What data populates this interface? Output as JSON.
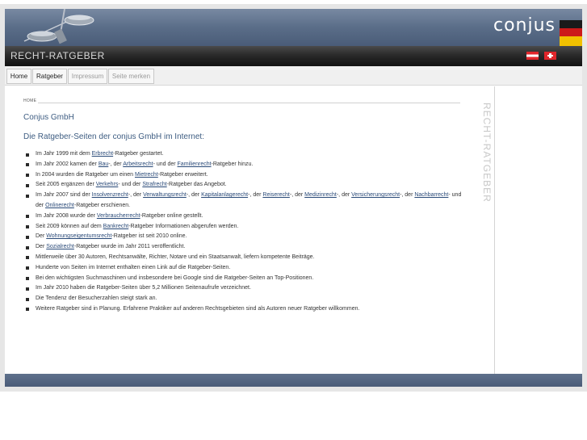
{
  "header": {
    "logo_text": "conjus",
    "site_title": "RECHT-RATGEBER",
    "flags": [
      "austria-flag-icon",
      "switzerland-flag-icon"
    ]
  },
  "nav": {
    "tabs": [
      {
        "label": "Home",
        "state": "active"
      },
      {
        "label": "Ratgeber",
        "state": "active"
      },
      {
        "label": "Impressum",
        "state": "inactive"
      },
      {
        "label": "Seite merken",
        "state": "inactive"
      }
    ]
  },
  "content": {
    "breadcrumb": "HOME",
    "company": "Conjus GmbH",
    "intro": "Die Ratgeber-Seiten der conjus GmbH im Internet:",
    "items": [
      [
        "Im Jahr 1999 mit dem ",
        {
          "link": "Erbrecht"
        },
        "-Ratgeber gestartet."
      ],
      [
        "Im Jahr 2002 kamen der ",
        {
          "link": "Bau"
        },
        "-, der ",
        {
          "link": "Arbeitsrecht"
        },
        "- und der ",
        {
          "link": "Familienrecht"
        },
        "-Ratgeber hinzu."
      ],
      [
        "In 2004 wurden die Ratgeber um einen ",
        {
          "link": "Mietrecht"
        },
        "-Ratgeber erweitert."
      ],
      [
        "Seit 2005 ergänzen der ",
        {
          "link": "Verkehrs"
        },
        "- und der ",
        {
          "link": "Strafrecht"
        },
        "-Ratgeber das Angebot."
      ],
      [
        "Im Jahr 2007 sind der ",
        {
          "link": "Insolvenzrecht"
        },
        "-, der ",
        {
          "link": "Verwaltungsrecht"
        },
        "-, der ",
        {
          "link": "Kapitalanlagerecht"
        },
        "-, der ",
        {
          "link": "Reiserecht"
        },
        "-, der ",
        {
          "link": "Medizinrecht"
        },
        "-, der ",
        {
          "link": "Versicherungsrecht"
        },
        "-, der ",
        {
          "link": "Nachbarrecht"
        },
        "- und der ",
        {
          "link": "Onlinerecht"
        },
        "-Ratgeber erschienen."
      ],
      [
        "Im Jahr 2008 wurde der ",
        {
          "link": "Verbraucherrecht"
        },
        "-Ratgeber online gestellt."
      ],
      [
        "Seit 2009 können auf dem ",
        {
          "link": "Bankrecht"
        },
        "-Ratgeber Informationen abgerufen werden."
      ],
      [
        "Der ",
        {
          "link": "Wohnungseigentumsrecht"
        },
        "-Ratgeber ist seit 2010 online."
      ],
      [
        "Der ",
        {
          "link": " Sozialrecht"
        },
        "-Ratgeber wurde im Jahr 2011 veröffentlicht."
      ],
      [
        "Mittlerweile über 30 Autoren, Rechtsanwälte, Richter, Notare und ein Staatsanwalt, liefern kompetente Beiträge."
      ],
      [
        "Hunderte von Seiten im Internet enthalten einen Link auf die Ratgeber-Seiten."
      ],
      [
        "Bei den wichtigsten Suchmaschinen und insbesondere bei Google sind die Ratgeber-Seiten an Top-Positionen."
      ],
      [
        "Im Jahr 2010 haben die Ratgeber-Seiten über 5,2 Millionen Seitenaufrufe verzeichnet."
      ],
      [
        "Die Tendenz der Besucherzahlen steigt stark an."
      ],
      [
        "Weitere Ratgeber sind in Planung. Erfahrene Praktiker auf anderen Rechtsgebieten sind als Autoren neuer Ratgeber willkommen."
      ]
    ]
  },
  "sidebar": {
    "label": "RECHT-RATGEBER"
  },
  "colors": {
    "banner": "#5a6d88",
    "titlebar": "#2a2a2a",
    "heading": "#3e5d82",
    "link": "#2a4a78"
  }
}
